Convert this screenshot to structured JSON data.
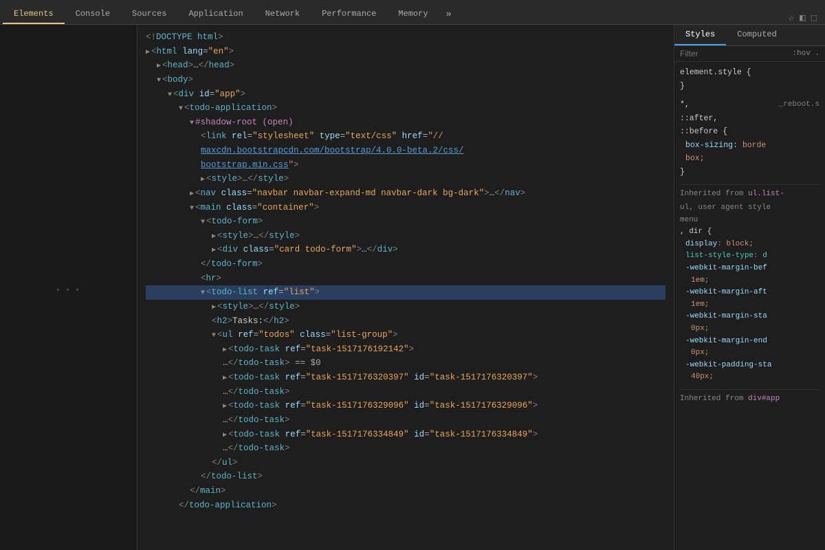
{
  "tabs": [
    {
      "label": "Elements",
      "active": true
    },
    {
      "label": "Console",
      "active": false
    },
    {
      "label": "Sources",
      "active": false
    },
    {
      "label": "Application",
      "active": false
    },
    {
      "label": "Network",
      "active": false
    },
    {
      "label": "Performance",
      "active": false
    },
    {
      "label": "Memory",
      "active": false
    }
  ],
  "tab_more": "»",
  "styles_tabs": [
    {
      "label": "Styles",
      "active": true
    },
    {
      "label": "Computed",
      "active": false
    }
  ],
  "filter_placeholder": "Filter",
  "filter_hint": ":hov  .",
  "gutter_dots": "...",
  "icons": {
    "star": "☆",
    "bookmark": "◧",
    "cursor": "⬚"
  }
}
